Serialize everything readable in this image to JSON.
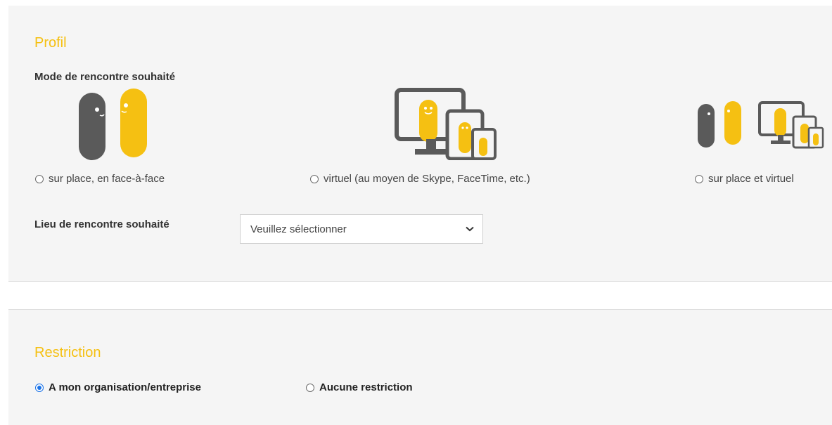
{
  "profil": {
    "title": "Profil",
    "mode_label": "Mode de rencontre souhaité",
    "mode_options": [
      {
        "label": "sur place, en face-à-face",
        "checked": false,
        "icon": "face-to-face-icon"
      },
      {
        "label": "virtuel (au moyen de Skype, FaceTime, etc.)",
        "checked": false,
        "icon": "virtual-devices-icon"
      },
      {
        "label": "sur place et virtuel",
        "checked": false,
        "icon": "hybrid-meeting-icon"
      }
    ],
    "lieu_label": "Lieu de rencontre souhaité",
    "lieu_select": {
      "value": "Veuillez sélectionner"
    }
  },
  "restriction": {
    "title": "Restriction",
    "options": [
      {
        "label": "A mon organisation/entreprise",
        "checked": true
      },
      {
        "label": "Aucune restriction",
        "checked": false
      }
    ]
  },
  "colors": {
    "accent": "#f5c012",
    "figure_dark": "#5a5a5a",
    "panel_bg": "#f5f5f5",
    "radio_selected": "#1a73e8"
  }
}
